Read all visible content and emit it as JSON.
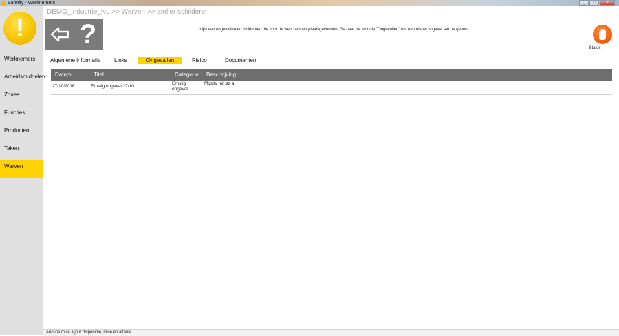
{
  "window": {
    "title": "Safetify - Werknemers",
    "minimize": "_",
    "maximize": "□",
    "close": "X"
  },
  "sidebar": {
    "items": [
      {
        "label": "Werknemers",
        "active": false
      },
      {
        "label": "Arbeidsmiddelen",
        "active": false
      },
      {
        "label": "Zones",
        "active": false
      },
      {
        "label": "Functies",
        "active": false
      },
      {
        "label": "Producten",
        "active": false
      },
      {
        "label": "Taken",
        "active": false
      },
      {
        "label": "Werven",
        "active": true
      }
    ]
  },
  "header": {
    "breadcrumb": "DEMO_industrie_NL >> Werven >> atelier schilderen",
    "help_glyph": "?",
    "info": "Lijst van ongevallen en incidenten die voor de werf hebben plaatsgevonden. Ga naar de module \"Ongevallen\" om een nieuw ongeval aan te geven",
    "status_label": "Status"
  },
  "tabs": [
    {
      "label": "Algemene informatie",
      "active": false
    },
    {
      "label": "Links",
      "active": false
    },
    {
      "label": "Ongevallen",
      "active": true
    },
    {
      "label": "Risico",
      "active": false
    },
    {
      "label": "Documenten",
      "active": false
    }
  ],
  "table": {
    "columns": [
      "Datum",
      "Titel",
      "Categorie",
      "Beschrijving:"
    ],
    "rows": [
      {
        "datum": "27/10/2016",
        "titel": "Ernstig ongeval 27/10",
        "categorie_line1": "Ernstig",
        "categorie_line2": "ongeval",
        "beschrijving": "fffqsdv ml ,az a"
      }
    ]
  },
  "statusbar": {
    "text": "Aucune mise à jour disponible, mise en attente."
  },
  "colors": {
    "accent": "#ffd200",
    "header_gray": "#6e6e6e",
    "status_orange": "#f05a0c"
  }
}
